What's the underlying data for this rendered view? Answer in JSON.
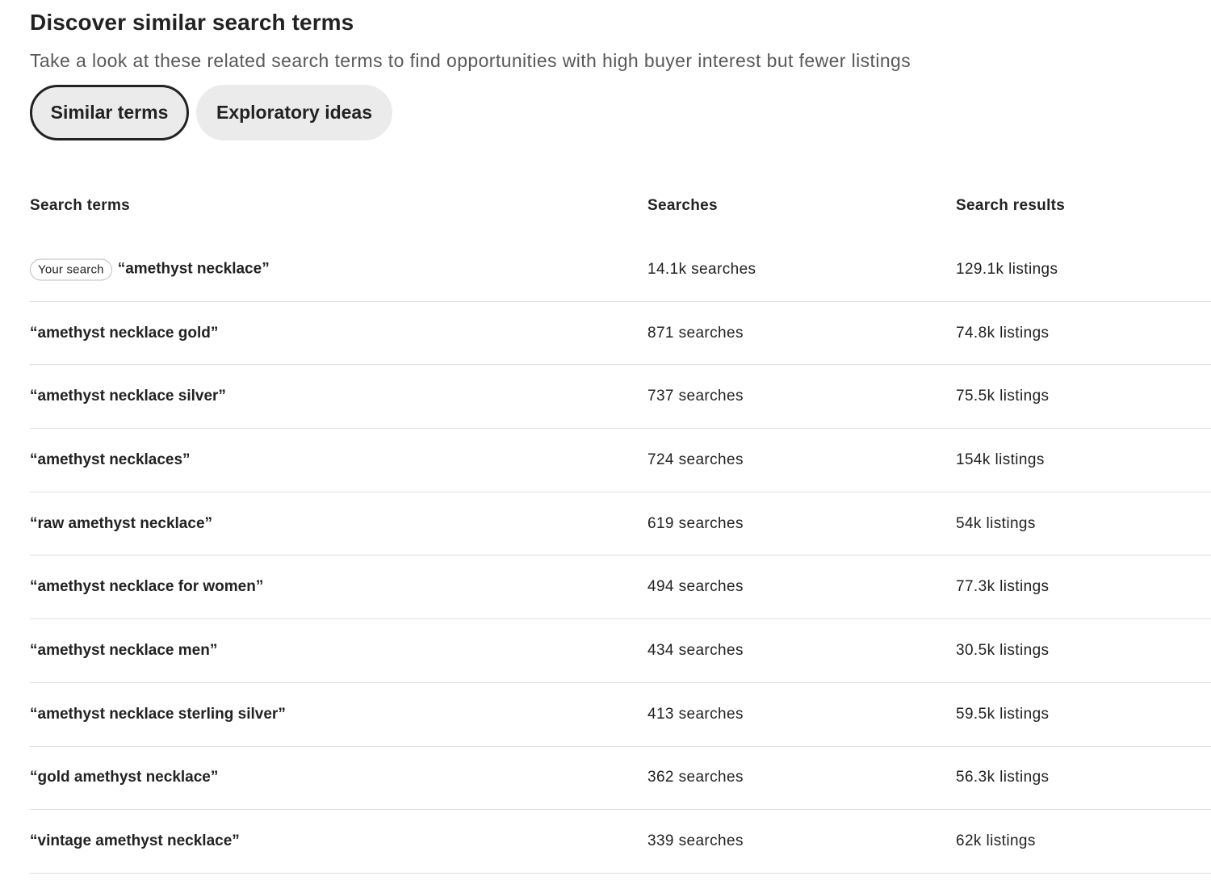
{
  "section": {
    "title": "Discover similar search terms",
    "subtitle": "Take a look at these related search terms to find opportunities with high buyer interest but fewer listings"
  },
  "tabs": [
    {
      "label": "Similar terms",
      "active": true
    },
    {
      "label": "Exploratory ideas",
      "active": false
    }
  ],
  "table": {
    "headers": {
      "term": "Search terms",
      "searches": "Searches",
      "results": "Search results"
    },
    "your_search_badge": "Your search",
    "rows": [
      {
        "term": "“amethyst necklace”",
        "searches": "14.1k searches",
        "results": "129.1k listings",
        "is_your_search": true
      },
      {
        "term": "“amethyst necklace gold”",
        "searches": "871 searches",
        "results": "74.8k listings"
      },
      {
        "term": "“amethyst necklace silver”",
        "searches": "737 searches",
        "results": "75.5k listings"
      },
      {
        "term": "“amethyst necklaces”",
        "searches": "724 searches",
        "results": "154k listings"
      },
      {
        "term": "“raw amethyst necklace”",
        "searches": "619 searches",
        "results": "54k listings"
      },
      {
        "term": "“amethyst necklace for women”",
        "searches": "494 searches",
        "results": "77.3k listings"
      },
      {
        "term": "“amethyst necklace men”",
        "searches": "434 searches",
        "results": "30.5k listings"
      },
      {
        "term": "“amethyst necklace sterling silver”",
        "searches": "413 searches",
        "results": "59.5k listings"
      },
      {
        "term": "“gold amethyst necklace”",
        "searches": "362 searches",
        "results": "56.3k listings"
      },
      {
        "term": "“vintage amethyst necklace”",
        "searches": "339 searches",
        "results": "62k listings"
      }
    ]
  }
}
